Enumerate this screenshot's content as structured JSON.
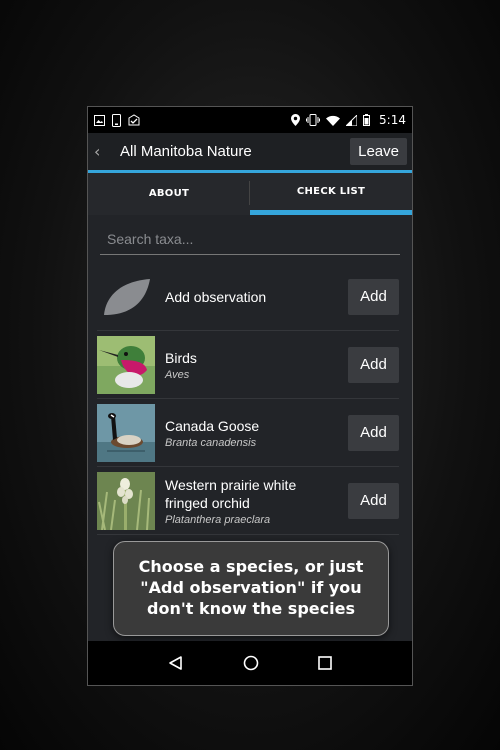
{
  "status_bar": {
    "time": "5:14",
    "icons_left": [
      "image-icon",
      "phone-icon",
      "inbox-icon"
    ],
    "icons_right": [
      "location-icon",
      "vibrate-icon",
      "wifi-icon",
      "signal-icon",
      "battery-icon"
    ]
  },
  "app_bar": {
    "title": "All Manitoba Nature",
    "back_label": "‹",
    "leave_label": "Leave"
  },
  "tabs": [
    {
      "label": "ABOUT",
      "active": false
    },
    {
      "label": "CHECK LIST",
      "active": true
    }
  ],
  "search": {
    "placeholder": "Search taxa..."
  },
  "list": {
    "add_observation_label": "Add observation",
    "add_label": "Add",
    "items": [
      {
        "name_line1": "Birds",
        "name_line2": "",
        "scientific": "Aves"
      },
      {
        "name_line1": "Canada Goose",
        "name_line2": "",
        "scientific": "Branta canadensis"
      },
      {
        "name_line1": "Western prairie white",
        "name_line2": "fringed orchid",
        "scientific": "Platanthera praeclara"
      }
    ]
  },
  "tooltip": {
    "line1": "Choose a species, or just",
    "line2": "\"Add observation\" if you",
    "line3": "don't know the species"
  },
  "colors": {
    "accent": "#35a6dc",
    "background": "#222428",
    "button": "#3a3c40"
  }
}
